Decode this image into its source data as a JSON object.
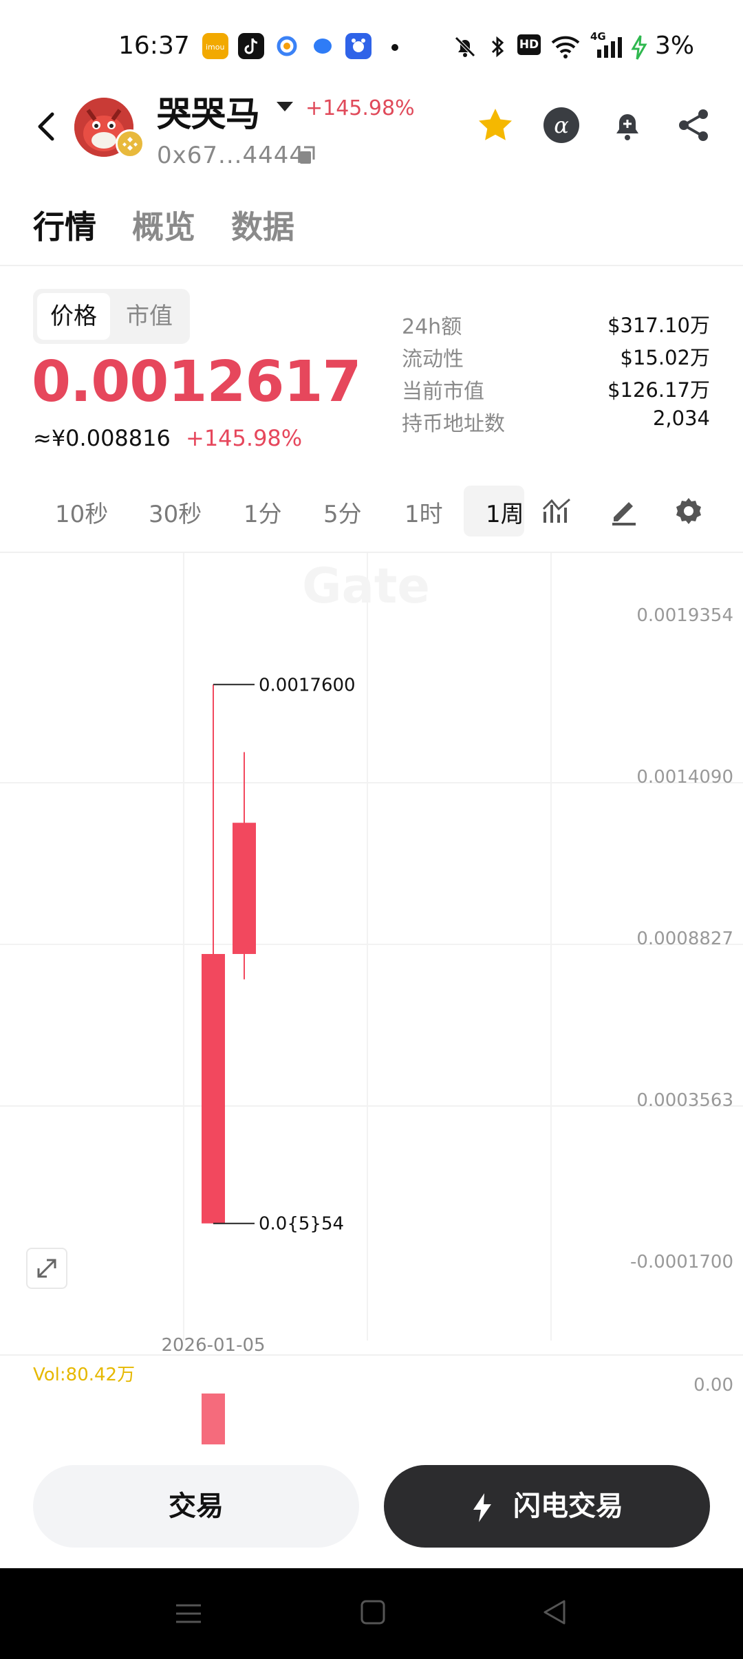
{
  "status_bar": {
    "time": "16:37",
    "battery": "3%",
    "app_icons": [
      "imou-app-icon",
      "tiktok-app-icon",
      "browser-app-icon",
      "blue-app-icon",
      "baidu-app-icon"
    ],
    "right_icons": [
      "mute-icon",
      "bluetooth-icon",
      "hd-icon",
      "wifi-icon",
      "4g-signal-icon",
      "charging-icon"
    ],
    "hd_label": "HD",
    "network_label": "4G"
  },
  "header": {
    "token_name": "哭哭马",
    "change": "+145.98%",
    "contract": "0x67...4444"
  },
  "tabs": [
    {
      "label": "行情",
      "active": true
    },
    {
      "label": "概览",
      "active": false
    },
    {
      "label": "数据",
      "active": false
    }
  ],
  "price_panel": {
    "segment": [
      {
        "label": "价格",
        "active": true
      },
      {
        "label": "市值",
        "active": false
      }
    ],
    "price": "0.0012617",
    "fiat_price": "≈¥0.008816",
    "change": "+145.98%",
    "stats": [
      {
        "label": "24h额",
        "value": "$317.10万"
      },
      {
        "label": "流动性",
        "value": "$15.02万"
      },
      {
        "label": "当前市值",
        "value": "$126.17万"
      },
      {
        "label": "持币地址数",
        "value": "2,034"
      }
    ]
  },
  "intervals": [
    {
      "label": "10秒",
      "active": false
    },
    {
      "label": "30秒",
      "active": false
    },
    {
      "label": "1分",
      "active": false
    },
    {
      "label": "5分",
      "active": false
    },
    {
      "label": "1时",
      "active": false
    },
    {
      "label": "1周",
      "active": true
    }
  ],
  "colors": {
    "up": "#f2485e",
    "accent_price": "#e6475c",
    "star": "#f5b800",
    "vol_label": "#e6b800"
  },
  "chart_data": {
    "type": "candlestick",
    "y_ticks": [
      "0.0019354",
      "0.0014090",
      "0.0008827",
      "0.0003563",
      "-0.0001700"
    ],
    "ylim": [
      -0.00017,
      0.0019354
    ],
    "x_labels": [
      "2026-01-05"
    ],
    "candles": [
      {
        "open": 5.4e-06,
        "close": 0.0008827,
        "high": 0.00176,
        "low": 5.4e-06
      },
      {
        "open": 0.0008827,
        "close": 0.00131,
        "high": 0.00154,
        "low": 0.0008
      }
    ],
    "annotations": {
      "high": "0.0017600",
      "low": "0.0{5}54"
    },
    "watermark": "Gate",
    "volume": {
      "label": "Vol:80.42万",
      "axis_label": "0.00",
      "bars": [
        804200
      ]
    }
  },
  "actions": {
    "trade": "交易",
    "flash_trade": "闪电交易"
  }
}
